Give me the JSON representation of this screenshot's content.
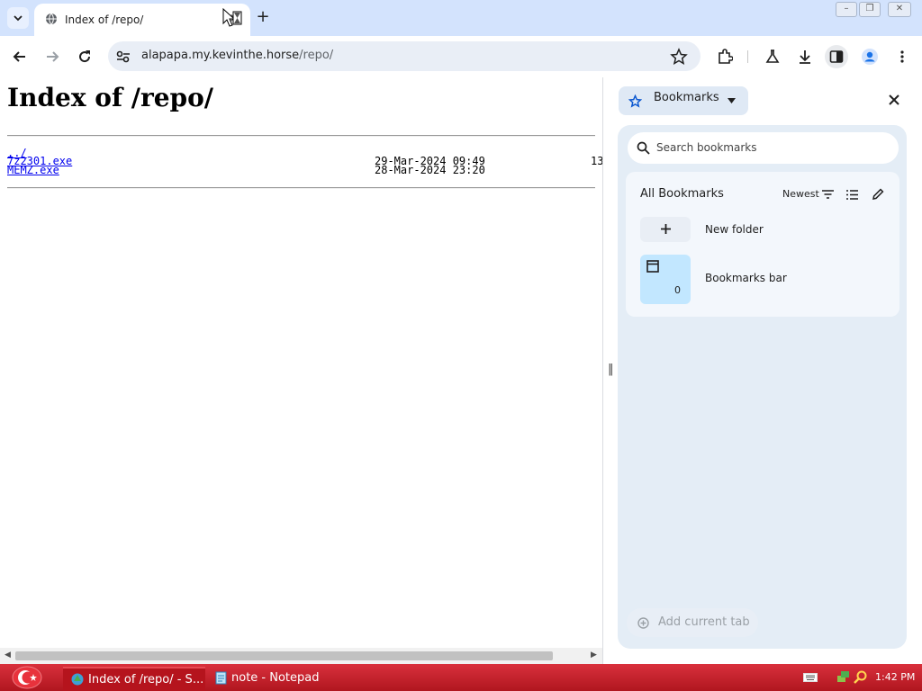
{
  "tab": {
    "title": "Index of /repo/",
    "close_glyph": "×",
    "new_tab_glyph": "+",
    "dropdown_glyph": "⌄"
  },
  "window_controls": {
    "minimize": "–",
    "restore": "❐",
    "close": "✕"
  },
  "omnibox": {
    "host": "alapapa.my.kevinthe.horse",
    "path": "/repo/"
  },
  "page": {
    "heading": "Index of /repo/",
    "listing": [
      {
        "name": "../",
        "date": "",
        "size": ""
      },
      {
        "name": "7z2301.exe",
        "date": "29-Mar-2024 09:49",
        "size": "13"
      },
      {
        "name": "MEMZ.exe",
        "date": "28-Mar-2024 23:20",
        "size": ""
      }
    ]
  },
  "side_panel": {
    "selector_label": "Bookmarks",
    "search_placeholder": "Search bookmarks",
    "folder_title": "All Bookmarks",
    "sort_label": "Newest",
    "new_folder_label": "New folder",
    "bookmarks_bar": {
      "label": "Bookmarks bar",
      "count": "0"
    },
    "add_current_tab": "Add current tab",
    "resize_glyph": "‖"
  },
  "taskbar": {
    "items": [
      {
        "label": "Index of /repo/ - S..."
      },
      {
        "label": "note - Notepad"
      }
    ],
    "clock": "1:42 PM"
  },
  "colors": {
    "tabstrip": "#d3e3fd",
    "panel_bg": "#e4edf6",
    "taskbar": "#c21f28",
    "link": "#0000ee",
    "bookmarks_bar_tile": "#c2e7ff"
  }
}
